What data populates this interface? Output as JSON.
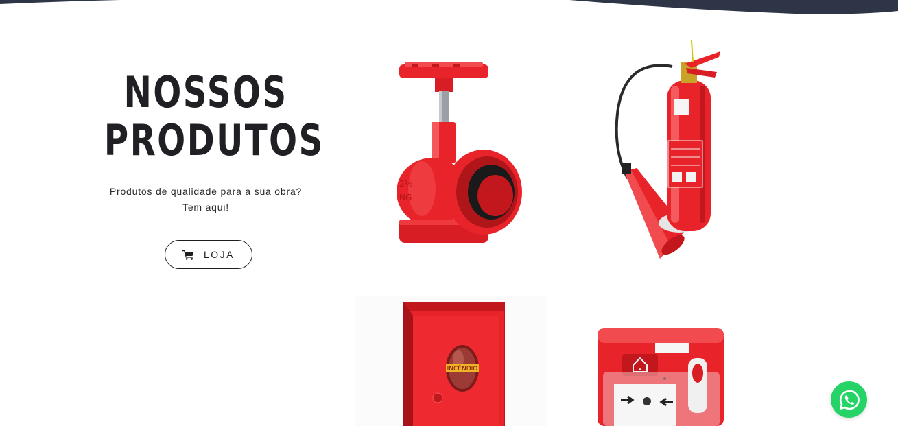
{
  "products_section": {
    "title_line1": "NOSSOS",
    "title_line2": "PRODUTOS",
    "subtitle_line1": "Produtos de qualidade para a sua obra?",
    "subtitle_line2": "Tem aqui!",
    "shop_button_label": "LOJA",
    "shop_button_icon": "shopping-cart-icon"
  },
  "products": [
    {
      "name": "valve",
      "icon": "fire-hydrant-valve"
    },
    {
      "name": "extinguisher",
      "icon": "fire-extinguisher"
    },
    {
      "name": "cabinet",
      "icon": "fire-hose-cabinet",
      "label": "INCÊNDIO"
    },
    {
      "name": "alarm",
      "icon": "manual-call-point"
    }
  ],
  "floating": {
    "whatsapp_icon": "whatsapp-icon",
    "color": "#25d366"
  },
  "colors": {
    "header_dark": "#2d3547",
    "product_red": "#e8242a",
    "title": "#1f1f24"
  }
}
